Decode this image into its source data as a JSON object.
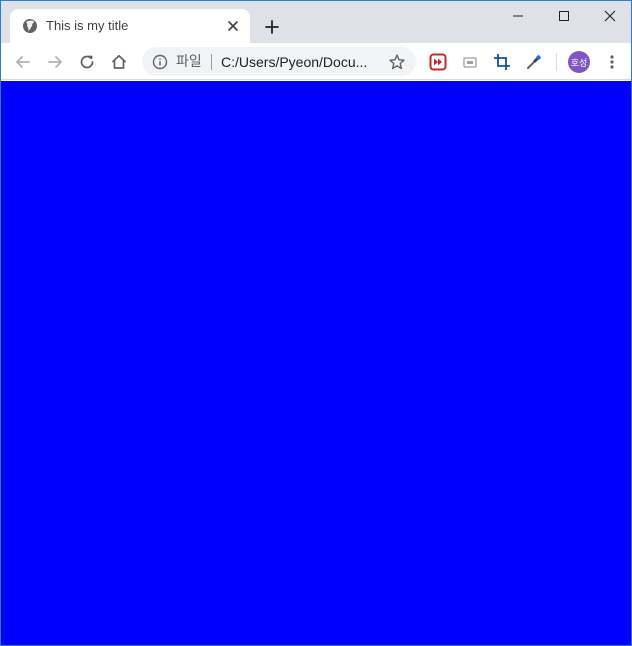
{
  "tab": {
    "title": "This is my title",
    "favicon_icon": "globe-icon"
  },
  "window_controls": {
    "minimize_icon": "minimize-icon",
    "maximize_icon": "maximize-icon",
    "close_icon": "close-icon"
  },
  "omnibox": {
    "scheme_label": "파일",
    "url": "C:/Users/Pyeon/Docu..."
  },
  "profile": {
    "initials": "호성",
    "color": "#7e57c2"
  },
  "page": {
    "background_color": "#0000ff"
  },
  "colors": {
    "tabstrip": "#dee1e6",
    "accent_border": "#2b7ed6"
  }
}
